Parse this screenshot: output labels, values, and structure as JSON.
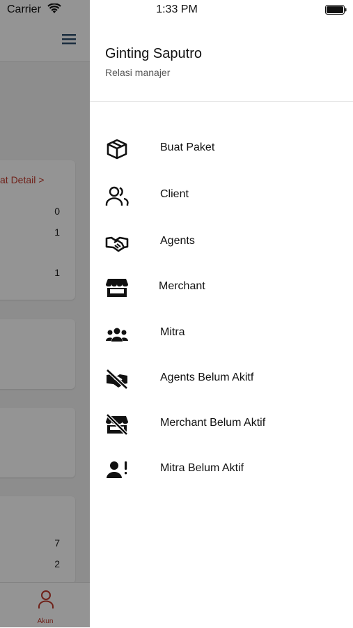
{
  "status_bar": {
    "carrier": "Carrier",
    "time": "1:33 PM"
  },
  "background": {
    "link_text": "at Detail  >",
    "numbers": [
      "0",
      "1",
      "1",
      "7",
      "2"
    ],
    "tab": {
      "label": "Akun",
      "icon": "person-icon"
    },
    "accent_color": "#c0392b"
  },
  "drawer": {
    "user_name": "Ginting Saputro",
    "user_role": "Relasi manajer",
    "items": [
      {
        "label": "Buat Paket",
        "icon": "package-icon"
      },
      {
        "label": "Client",
        "icon": "users-icon"
      },
      {
        "label": "Agents",
        "icon": "handshake-icon"
      },
      {
        "label": "Merchant",
        "icon": "store-icon"
      },
      {
        "label": "Mitra",
        "icon": "people-group-icon"
      },
      {
        "label": "Agents Belum Akitf",
        "icon": "handshake-slash-icon"
      },
      {
        "label": "Merchant Belum Aktif",
        "icon": "store-slash-icon"
      },
      {
        "label": "Mitra Belum Aktif",
        "icon": "user-alert-icon"
      }
    ]
  }
}
